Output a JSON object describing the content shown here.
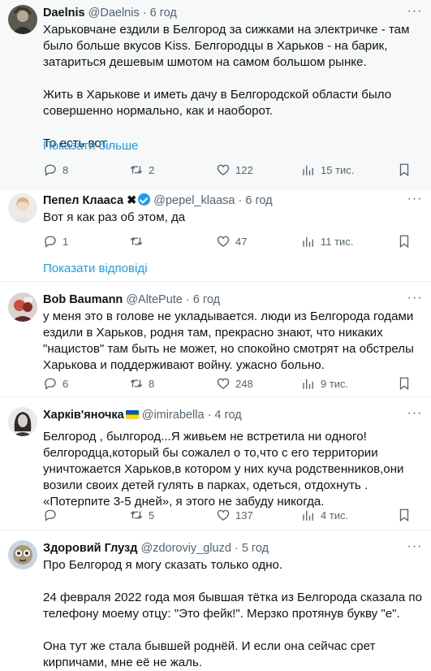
{
  "tweets": [
    {
      "name": "Daelnis",
      "handle": "@Daelnis",
      "time": "6 год",
      "text": "Харьковчане ездили в Белгород за сижками на электричке - там было больше вкусов Kiss. Белгородцы в Харьков - на барик, затариться дешевым шмотом на самом большом рынке.\n\nЖить в Харькове и иметь дачу в Белгородской области было совершенно нормально, как и наоборот.\n\nТо есть вот...",
      "show_more": "Показати більше",
      "replies": "8",
      "retweets": "2",
      "likes": "122",
      "views": "15 тис."
    },
    {
      "name": "Пепел Клааса",
      "name_suffix": "✖",
      "handle": "@pepel_klaasa",
      "time": "6 год",
      "text": "Вот я как раз об этом, да",
      "replies": "1",
      "retweets": "",
      "likes": "47",
      "views": "11 тис."
    },
    {
      "name": "Bob Baumann",
      "handle": "@AltePute",
      "time": "6 год",
      "text": "у меня это в голове не укладывается. люди из Белгорода годами ездили в Харьков, родня там, прекрасно знают, что никаких \"нацистов\" там быть не может, но спокойно смотрят на обстрелы Харькова и поддерживают войну. ужасно больно.",
      "replies": "6",
      "retweets": "8",
      "likes": "248",
      "views": "9 тис."
    },
    {
      "name": "Харків'яночка",
      "handle": "@imirabella",
      "time": "4 год",
      "text": "Белгород , былгород...Я живьем не встретила ни одного! белгородца,который бы сожалел о то,что с его территории уничтожается Харьков,в котором у них куча родственников,они возили своих детей гулять в парках, одеться, отдохнуть . «Потерпите 3-5 дней», я этого не забуду никогда.",
      "replies": "",
      "retweets": "5",
      "likes": "137",
      "views": "4 тис."
    },
    {
      "name": "Здоровий Глузд",
      "handle": "@zdoroviy_gluzd",
      "time": "5 год",
      "text": "Про Белгород я могу сказать только одно.\n\n24 февраля 2022 года моя бывшая тётка из Белгорода сказала по телефону моему отцу: \"Это фейк!\". Мерзко протянув букву \"е\".\n\nОна тут же стала бывшей роднёй. И если она сейчас срет кирпичами, мне её не жаль."
    }
  ],
  "show_replies": "Показати відповіді",
  "colors": {
    "accent": "#1d9bf0",
    "muted": "#536471",
    "text": "#0f1419"
  },
  "icons": [
    "reply-icon",
    "retweet-icon",
    "like-icon",
    "views-icon",
    "bookmark-icon",
    "more-icon",
    "verified-badge-icon",
    "ukraine-flag-icon"
  ]
}
